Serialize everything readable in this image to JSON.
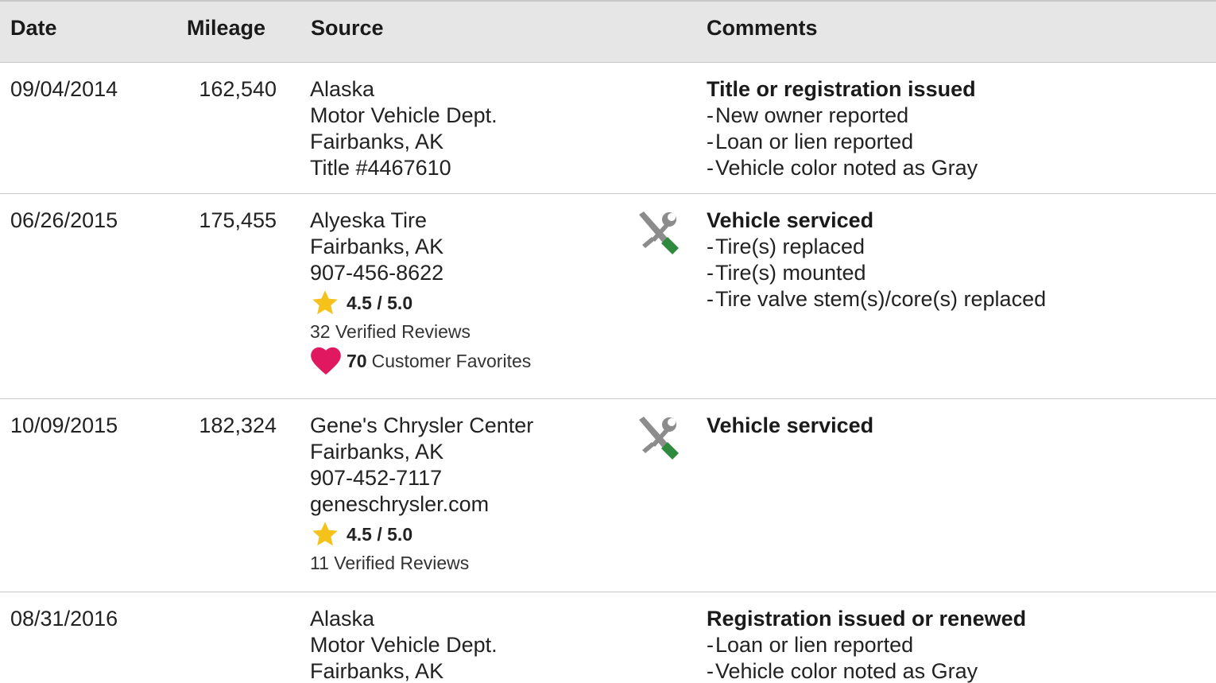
{
  "table": {
    "headers": {
      "date": "Date",
      "mileage": "Mileage",
      "source": "Source",
      "comments": "Comments"
    },
    "rows": [
      {
        "date": "09/04/2014",
        "mileage": "162,540",
        "source": [
          "Alaska",
          "Motor Vehicle Dept.",
          "Fairbanks, AK",
          "Title #4467610"
        ],
        "comment_title": "Title or registration issued",
        "comment_items": [
          "New owner reported",
          "Loan or lien reported",
          "Vehicle color noted as Gray"
        ]
      },
      {
        "date": "06/26/2015",
        "mileage": "175,455",
        "source": [
          "Alyeska Tire",
          "Fairbanks, AK",
          "907-456-8622"
        ],
        "rating": "4.5 / 5.0",
        "reviews": "32 Verified Reviews",
        "favorites_count": "70",
        "favorites_label": "Customer Favorites",
        "icon": "service-tools-icon",
        "comment_title": "Vehicle serviced",
        "comment_items": [
          "Tire(s) replaced",
          "Tire(s) mounted",
          "Tire valve stem(s)/core(s) replaced"
        ]
      },
      {
        "date": "10/09/2015",
        "mileage": "182,324",
        "source": [
          "Gene's Chrysler Center",
          "Fairbanks, AK",
          "907-452-7117",
          "geneschrysler.com"
        ],
        "rating": "4.5 / 5.0",
        "reviews": "11 Verified Reviews",
        "icon": "service-tools-icon",
        "comment_title": "Vehicle serviced"
      },
      {
        "date": "08/31/2016",
        "mileage": "",
        "source": [
          "Alaska",
          "Motor Vehicle Dept.",
          "Fairbanks, AK"
        ],
        "comment_title": "Registration issued or renewed",
        "comment_items": [
          "Loan or lien reported",
          "Vehicle color noted as Gray"
        ]
      }
    ]
  },
  "colors": {
    "header_bg": "#e6e6e6",
    "star": "#f5c21b",
    "heart": "#e0185f",
    "wrench_gray": "#8c8c8c",
    "screwdriver_green": "#2e8b3e"
  }
}
